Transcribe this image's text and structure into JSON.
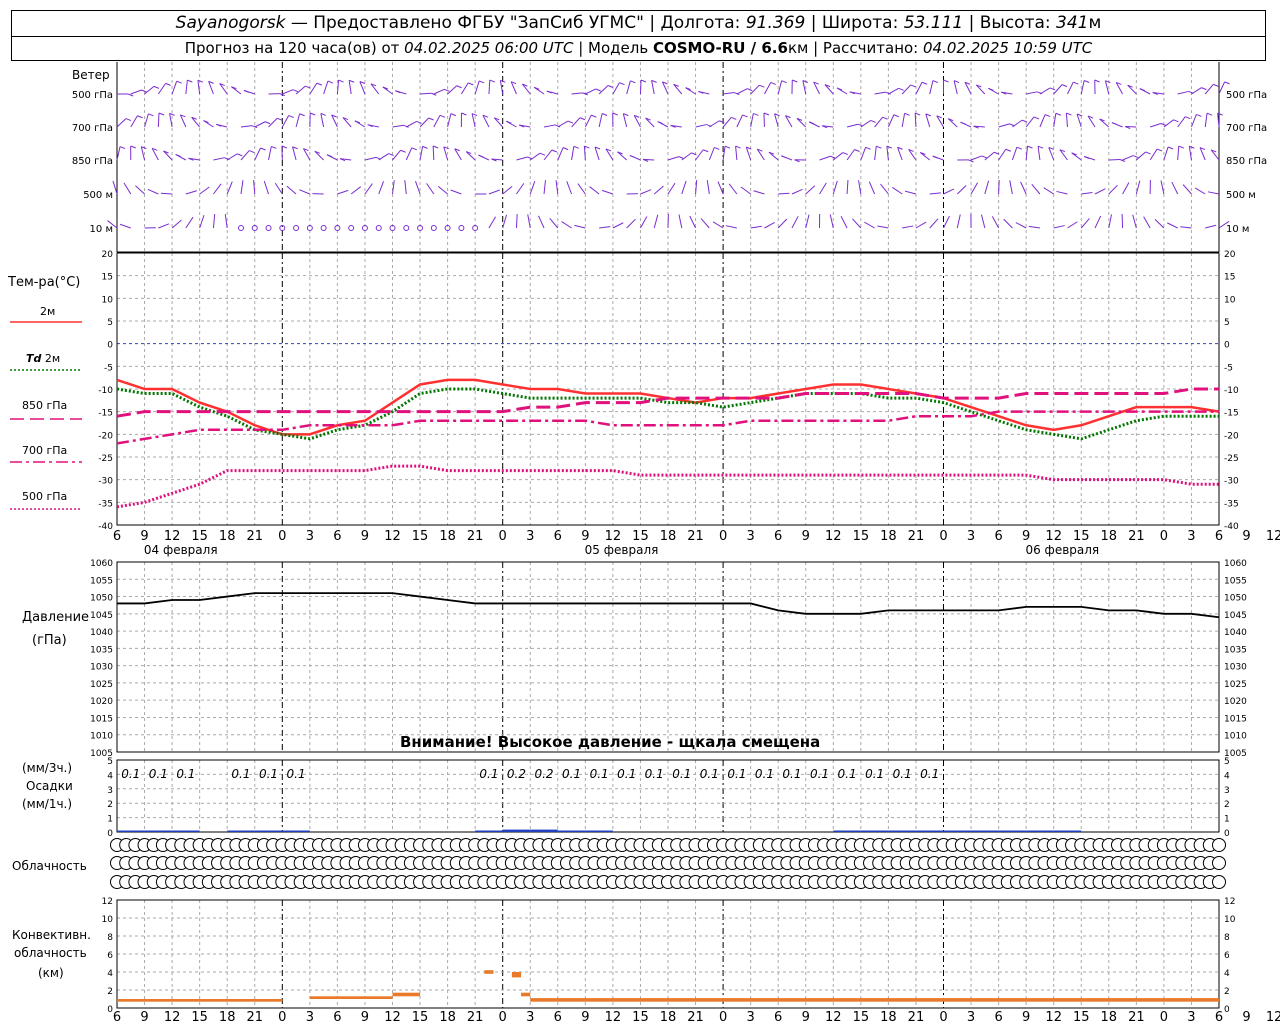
{
  "header": {
    "station": "Sayanogorsk",
    "provider": "— Предоставлено ФГБУ \"ЗапСиб УГМС\"",
    "lon_label": "Долгота:",
    "lon_value": "91.369",
    "lat_label": "Широта:",
    "lat_value": "53.111",
    "alt_label": "Высота:",
    "alt_value": "341",
    "alt_unit": "м",
    "forecast_prefix": "Прогноз на 120 часа(ов)  от",
    "forecast_start": "04.02.2025 06:00 UTC",
    "model_label": "Модель",
    "model_name": "COSMO-RU / 6.6",
    "model_unit": "км",
    "calc_label": "Рассчитано:",
    "calc_time": "04.02.2025 10:59 UTC"
  },
  "warning": "Внимание! Высокое давление - щкала смещена",
  "panel_labels": {
    "wind": "Ветер",
    "wind_levels": [
      "500 гПа",
      "700 гПа",
      "850 гПа",
      "500 м",
      "10  м"
    ],
    "temp_title": "Тем-ра(°С)",
    "temp_2m": "2м",
    "td_symbol": "Td",
    "td_2m": "2м",
    "t850": "850 гПа",
    "t700": "700 гПа",
    "t500": "500 гПа",
    "pressure_title": "Давление",
    "pressure_unit": "(гПа)",
    "precip_unit3": "(мм/3ч.)",
    "precip_title": "Осадки",
    "precip_unit1": "(мм/1ч.)",
    "cloud_title": "Облачность",
    "conv_title1": "Конвективн.",
    "conv_title2": "облачность",
    "conv_unit": "(км)"
  },
  "chart_data": [
    {
      "type": "line",
      "panel": "temperature",
      "x_hours": [
        0,
        3,
        6,
        9,
        12,
        15,
        18,
        21,
        24,
        27,
        30,
        33,
        36,
        39,
        42,
        45,
        48,
        51,
        54,
        57,
        60,
        63,
        66,
        69,
        72,
        75,
        78,
        81,
        84,
        87,
        90,
        93,
        96,
        99,
        102,
        105,
        108,
        111,
        114,
        117,
        120
      ],
      "x_ticks": [
        "6",
        "9",
        "12",
        "15",
        "18",
        "21",
        "0",
        "3",
        "6",
        "9",
        "12",
        "15",
        "18",
        "21",
        "0",
        "3",
        "6",
        "9",
        "12",
        "15",
        "18",
        "21",
        "0",
        "3",
        "6",
        "9",
        "12",
        "15",
        "18",
        "21",
        "0",
        "3",
        "6",
        "9",
        "12",
        "15",
        "18",
        "21",
        "0",
        "3",
        "6",
        "9",
        "12"
      ],
      "dates": [
        "04 февраля",
        "05 февраля",
        "06 февраля"
      ],
      "ylim": [
        -40,
        20
      ],
      "y_ticks": [
        20,
        15,
        10,
        5,
        0,
        -5,
        -10,
        -15,
        -20,
        -25,
        -30,
        -35,
        -40
      ],
      "series": [
        {
          "name": "2м",
          "color": "#ff3030",
          "style": "solid",
          "values": [
            -8,
            -10,
            -10,
            -13,
            -15,
            -18,
            -20,
            -20,
            -18,
            -17,
            -13,
            -9,
            -8,
            -8,
            -9,
            -10,
            -10,
            -11,
            -11,
            -11,
            -12,
            -13,
            -12,
            -12,
            -11,
            -10,
            -9,
            -9,
            -10,
            -11,
            -12,
            -14,
            -16,
            -18,
            -19,
            -18,
            -16,
            -14,
            -14,
            -14,
            -15
          ]
        },
        {
          "name": "Td 2м",
          "color": "#007700",
          "style": "dotted",
          "values": [
            -10,
            -11,
            -11,
            -14,
            -16,
            -19,
            -20,
            -21,
            -19,
            -18,
            -15,
            -11,
            -10,
            -10,
            -11,
            -12,
            -12,
            -12,
            -12,
            -12,
            -13,
            -13,
            -14,
            -13,
            -12,
            -11,
            -11,
            -11,
            -12,
            -12,
            -13,
            -15,
            -17,
            -19,
            -20,
            -21,
            -19,
            -17,
            -16,
            -16,
            -16
          ]
        },
        {
          "name": "850 гПа",
          "color": "#e0107c",
          "style": "dashed",
          "values": [
            -16,
            -15,
            -15,
            -15,
            -15,
            -15,
            -15,
            -15,
            -15,
            -15,
            -15,
            -15,
            -15,
            -15,
            -15,
            -14,
            -14,
            -13,
            -13,
            -13,
            -12,
            -12,
            -12,
            -12,
            -12,
            -11,
            -11,
            -11,
            -11,
            -11,
            -12,
            -12,
            -12,
            -11,
            -11,
            -11,
            -11,
            -11,
            -11,
            -10,
            -10
          ]
        },
        {
          "name": "700 гПа",
          "color": "#e0107c",
          "style": "dashdot",
          "values": [
            -22,
            -21,
            -20,
            -19,
            -19,
            -19,
            -19,
            -18,
            -18,
            -18,
            -18,
            -17,
            -17,
            -17,
            -17,
            -17,
            -17,
            -17,
            -18,
            -18,
            -18,
            -18,
            -18,
            -17,
            -17,
            -17,
            -17,
            -17,
            -17,
            -16,
            -16,
            -16,
            -15,
            -15,
            -15,
            -15,
            -15,
            -15,
            -15,
            -15,
            -15
          ]
        },
        {
          "name": "500 гПа",
          "color": "#e0107c",
          "style": "dotted",
          "values": [
            -36,
            -35,
            -33,
            -31,
            -28,
            -28,
            -28,
            -28,
            -28,
            -28,
            -27,
            -27,
            -28,
            -28,
            -28,
            -28,
            -28,
            -28,
            -28,
            -29,
            -29,
            -29,
            -29,
            -29,
            -29,
            -29,
            -29,
            -29,
            -29,
            -29,
            -29,
            -29,
            -29,
            -29,
            -30,
            -30,
            -30,
            -30,
            -30,
            -31,
            -31
          ]
        }
      ]
    },
    {
      "type": "line",
      "panel": "pressure",
      "ylim": [
        1005,
        1060
      ],
      "y_ticks": [
        1060,
        1055,
        1050,
        1045,
        1040,
        1035,
        1030,
        1025,
        1020,
        1015,
        1010,
        1005
      ],
      "series": [
        {
          "name": "Давление",
          "color": "#000000",
          "values": [
            1048,
            1048,
            1049,
            1049,
            1050,
            1051,
            1051,
            1051,
            1051,
            1051,
            1051,
            1050,
            1049,
            1048,
            1048,
            1048,
            1048,
            1048,
            1048,
            1048,
            1048,
            1048,
            1048,
            1048,
            1046,
            1045,
            1045,
            1045,
            1046,
            1046,
            1046,
            1046,
            1046,
            1047,
            1047,
            1047,
            1046,
            1046,
            1045,
            1045,
            1044
          ]
        }
      ]
    },
    {
      "type": "bar",
      "panel": "precipitation",
      "ylim": [
        0,
        5
      ],
      "y_ticks": [
        5,
        4,
        3,
        2,
        1,
        0
      ],
      "labels_x_hours": [
        1.5,
        4.5,
        7.5,
        13.5,
        16.5,
        19.5,
        40.5,
        43.5,
        46.5,
        49.5,
        52.5,
        55.5,
        58.5,
        61.5,
        64.5,
        67.5,
        70.5,
        73.5,
        76.5,
        79.5,
        82.5,
        85.5,
        88.5
      ],
      "labels": [
        "0.1",
        "0.1",
        "0.1",
        "0.1",
        "0.1",
        "0.1",
        "0.1",
        "0.2",
        "0.2",
        "0.1",
        "0.1",
        "0.1",
        "0.1",
        "0.1",
        "0.1",
        "0.1",
        "0.1",
        "0.1",
        "0.1",
        "0.1",
        "0.1",
        "0.1",
        "0.1"
      ],
      "bars_mm_per_3h": [
        0.1,
        0.1,
        0.1,
        0,
        0.1,
        0.1,
        0.1,
        0,
        0,
        0,
        0,
        0,
        0,
        0.1,
        0.2,
        0.2,
        0.1,
        0.1,
        0,
        0,
        0,
        0,
        0,
        0,
        0,
        0,
        0.1,
        0.1,
        0.1,
        0.1,
        0.1,
        0.1,
        0.1,
        0.1,
        0.1,
        0,
        0,
        0,
        0,
        0
      ]
    },
    {
      "type": "bar",
      "panel": "convective_clouds",
      "ylim": [
        0,
        12
      ],
      "y_ticks": [
        12,
        10,
        8,
        6,
        4,
        2,
        0
      ],
      "segments": [
        {
          "x": [
            0,
            18
          ],
          "top": 1,
          "bottom": 0.7
        },
        {
          "x": [
            21,
            30
          ],
          "top": 1.3,
          "bottom": 1.0
        },
        {
          "x": [
            30,
            33
          ],
          "top": 1.7,
          "bottom": 1.3
        },
        {
          "x": [
            40,
            41
          ],
          "top": 4.2,
          "bottom": 3.8
        },
        {
          "x": [
            43,
            44
          ],
          "top": 4.0,
          "bottom": 3.4
        },
        {
          "x": [
            44,
            45
          ],
          "top": 1.7,
          "bottom": 1.3
        },
        {
          "x": [
            45,
            120
          ],
          "top": 1.1,
          "bottom": 0.7
        }
      ]
    }
  ],
  "cloud_cover": {
    "rows": [
      [
        0,
        0,
        0,
        0,
        0,
        0,
        0,
        0,
        0,
        0,
        0,
        0,
        0,
        0,
        0,
        0,
        0,
        0,
        0,
        0,
        0,
        0,
        0,
        0,
        0,
        0,
        0,
        0,
        0,
        0,
        0,
        0,
        0,
        0,
        0,
        0,
        0,
        0,
        0,
        0,
        0,
        0,
        0,
        0,
        0,
        0,
        0,
        0,
        0,
        0,
        0,
        0,
        0,
        0,
        0,
        0,
        0,
        0,
        0,
        0,
        0,
        0,
        0,
        0,
        0,
        0,
        0,
        0,
        0,
        0,
        0,
        0,
        0,
        0,
        0,
        0,
        0,
        0,
        0,
        0,
        0,
        0,
        0,
        0,
        0,
        0,
        0,
        0,
        0,
        0,
        0,
        0,
        0,
        0,
        0,
        0,
        0,
        0,
        0,
        0,
        0,
        0,
        0,
        0,
        0,
        0,
        0,
        0,
        0,
        0,
        0,
        0,
        0,
        0,
        0,
        0,
        0,
        0,
        0,
        0,
        0
      ],
      [
        0,
        0,
        0,
        0,
        0,
        0,
        0,
        0,
        0,
        0,
        0,
        0,
        0,
        0,
        0,
        0,
        0,
        0,
        0,
        0,
        0,
        0,
        0,
        0,
        0,
        0,
        0,
        0,
        0,
        0,
        0,
        0,
        0,
        0,
        0,
        0,
        0,
        0,
        0,
        0,
        0,
        0,
        0,
        0,
        0,
        0,
        0,
        0,
        0,
        0,
        0,
        0,
        0,
        0,
        0,
        0,
        0,
        0,
        0,
        0,
        0,
        0,
        0,
        0,
        0,
        0,
        0,
        0,
        0,
        0,
        0,
        0,
        0,
        0,
        0,
        0,
        0,
        0,
        0,
        0,
        0,
        0,
        0,
        0,
        0,
        0,
        0,
        0,
        0,
        0,
        0,
        0,
        0,
        0,
        0,
        0,
        0,
        0,
        0,
        0,
        0,
        0,
        0,
        0,
        0,
        0,
        0,
        0,
        0,
        0,
        0,
        0,
        0,
        0,
        0,
        0,
        0,
        0,
        0,
        0,
        0
      ],
      [
        0,
        0,
        0,
        0,
        0,
        0,
        0,
        0,
        0,
        0,
        0,
        0,
        0,
        0,
        0,
        0,
        0,
        0,
        0,
        0,
        0,
        0,
        0,
        0,
        0,
        0,
        0,
        0,
        0,
        0,
        0,
        0,
        0,
        0,
        0,
        0,
        0,
        0,
        0,
        0,
        0,
        0,
        0,
        0,
        0,
        0,
        0,
        0,
        0,
        0,
        0,
        0,
        0,
        0,
        0,
        0,
        0,
        0,
        0,
        0,
        0,
        0,
        0,
        0,
        0,
        0,
        0,
        0,
        0,
        0,
        0,
        0,
        0,
        0,
        0,
        0,
        0,
        0,
        0,
        0,
        0,
        0,
        0,
        0,
        0,
        0,
        0,
        0,
        0,
        0,
        0,
        0,
        0,
        0,
        0,
        0,
        0,
        0,
        0,
        0,
        0,
        0,
        0,
        0,
        0,
        0,
        0,
        0,
        0,
        0,
        0,
        0,
        0,
        0,
        0,
        0,
        0,
        0,
        0,
        0,
        0
      ]
    ]
  },
  "colors": {
    "wind_barbs": "#7a2ccf",
    "grid": "#aaaaaa",
    "zero_line": "#3040c0",
    "precip_bar": "#2040c0",
    "conv_bar": "#e87a2a"
  }
}
